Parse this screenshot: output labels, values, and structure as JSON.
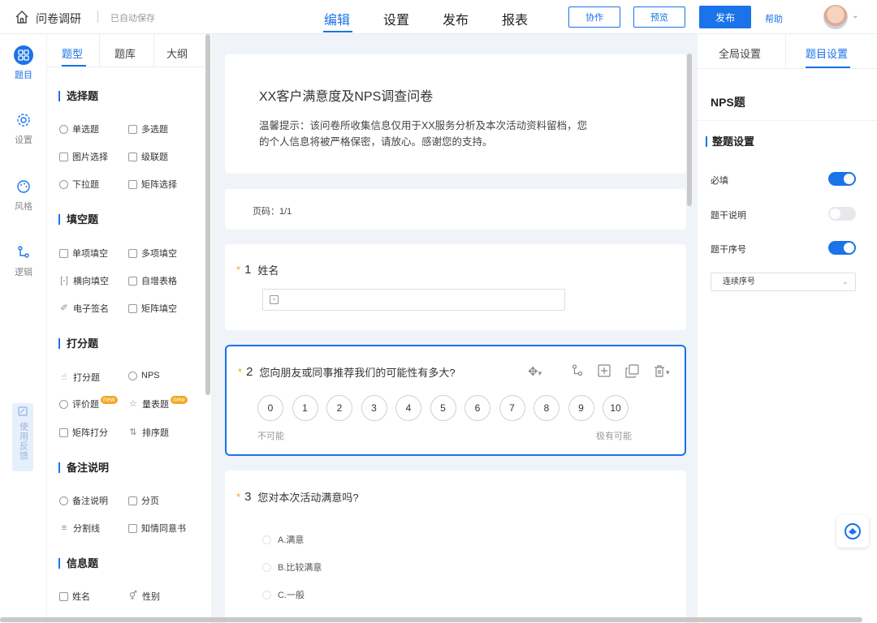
{
  "header": {
    "app_title": "问卷调研",
    "autosave": "已自动保存",
    "nav": [
      "编辑",
      "设置",
      "发布",
      "报表"
    ],
    "collab": "协作",
    "preview": "预览",
    "publish": "发布",
    "help": "帮助"
  },
  "rail": {
    "items": [
      {
        "label": "题目",
        "icon": "grid-icon"
      },
      {
        "label": "设置",
        "icon": "gear-icon"
      },
      {
        "label": "风格",
        "icon": "palette-icon"
      },
      {
        "label": "逻辑",
        "icon": "logic-icon"
      }
    ],
    "feedback": "使用反馈"
  },
  "panel": {
    "tabs": [
      "题型",
      "题库",
      "大纲"
    ],
    "sections": [
      {
        "title": "选择题",
        "items": [
          "单选题",
          "多选题",
          "图片选择",
          "级联题",
          "下拉题",
          "矩阵选择"
        ]
      },
      {
        "title": "填空题",
        "items": [
          "单项填空",
          "多项填空",
          "横向填空",
          "自增表格",
          "电子签名",
          "矩阵填空"
        ]
      },
      {
        "title": "打分题",
        "items": [
          "打分题",
          "NPS",
          "评价题",
          "量表题",
          "矩阵打分",
          "排序题"
        ]
      },
      {
        "title": "备注说明",
        "items": [
          "备注说明",
          "分页",
          "分割线",
          "知情同意书"
        ]
      },
      {
        "title": "信息题",
        "items": [
          "姓名",
          "性别"
        ]
      }
    ],
    "new_badge": "new"
  },
  "survey": {
    "title": "XX客户满意度及NPS调查问卷",
    "description": "温馨提示：该问卷所收集信息仅用于XX服务分析及本次活动资料留档，您的个人信息将被严格保密，请放心。感谢您的支持。",
    "page": "页码：1/1",
    "questions": [
      {
        "num": "1",
        "text": "姓名"
      },
      {
        "num": "2",
        "text": "您向朋友或同事推荐我们的可能性有多大?",
        "scale": [
          "0",
          "1",
          "2",
          "3",
          "4",
          "5",
          "6",
          "7",
          "8",
          "9",
          "10"
        ],
        "low": "不可能",
        "high": "极有可能"
      },
      {
        "num": "3",
        "text": "您对本次活动满意吗?",
        "options": [
          "A.满意",
          "B.比较满意",
          "C.一般"
        ]
      }
    ],
    "required_mark": "*"
  },
  "settings": {
    "tabs": [
      "全局设置",
      "题目设置"
    ],
    "title": "NPS题",
    "section": "整题设置",
    "rows": [
      {
        "label": "必填",
        "on": true
      },
      {
        "label": "题干说明",
        "on": false
      },
      {
        "label": "题干序号",
        "on": true
      }
    ],
    "numbering": "连续序号"
  },
  "colors": {
    "accent": "#1a73e8",
    "required": "#f5a623",
    "badge": "#f5a623"
  }
}
